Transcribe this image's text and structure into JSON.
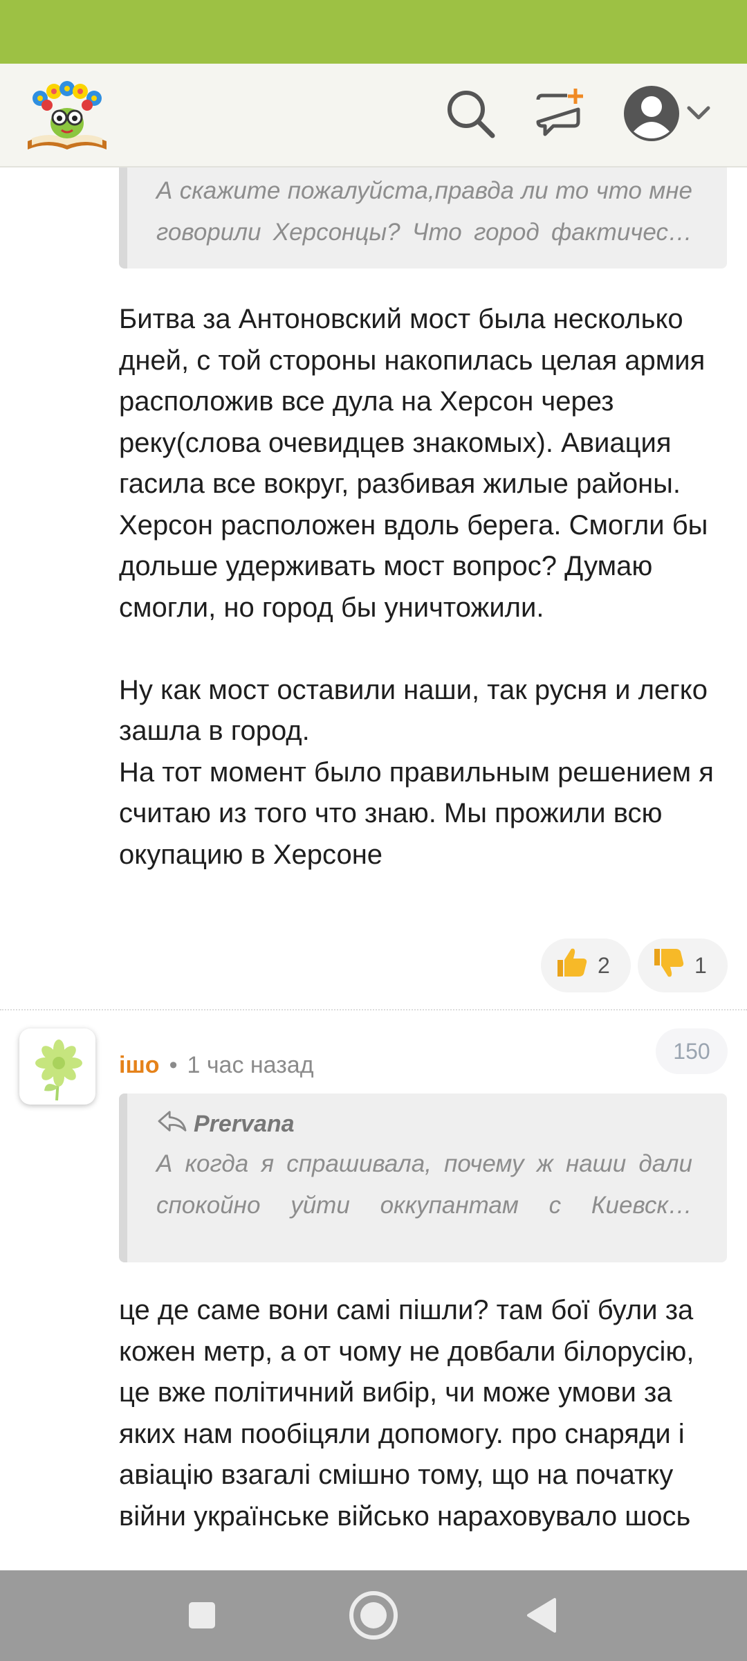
{
  "header": {
    "logo": "site-logo",
    "icons": [
      "search-icon",
      "new-post-icon",
      "user-avatar-icon",
      "chevron-down-icon"
    ]
  },
  "comment1": {
    "quote_text": "А скажите пожалуйста,правда ли то что мне говорили Херсонцы? Что город фактичес…",
    "body": [
      "Битва за Антоновский мост была несколько дней, с той стороны накопилась целая армия расположив все дула на Херсон через реку(слова очевидцев знакомых). Авиация гасила все вокруг, разбивая жилые районы. Херсон расположен вдоль берега. Смогли бы дольше удерживать мост вопрос? Думаю смогли, но город бы уничтожили.",
      "Ну как мост оставили наши, так русня и легко зашла в город.",
      "На тот момент было правильным решением я считаю из того что знаю. Мы прожили всю окупацию в Херсоне"
    ],
    "likes": "2",
    "dislikes": "1"
  },
  "comment2": {
    "author": "ішо",
    "separator": "•",
    "time": "1 час назад",
    "score": "150",
    "quote_author": "Prervana",
    "quote_text": "А когда я спрашивала, почему ж наши дали спокойно уйти оккупантам с Киевск…",
    "body": "це де саме вони самі пішли? там бої були за кожен метр, а от чому не довбали білорусію, це вже політичний вибір, чи може умови за яких нам пообіцяли допомогу. про снаряди і авіацію взагалі смішно тому, що на початку війни українське військо нараховувало шось"
  },
  "colors": {
    "status_bar": "#9dc144",
    "author": "#e5821a",
    "nav_bar": "#9b9b9b"
  },
  "navbar": {
    "icons": [
      "recents-square-icon",
      "home-circle-icon",
      "back-triangle-icon"
    ]
  }
}
